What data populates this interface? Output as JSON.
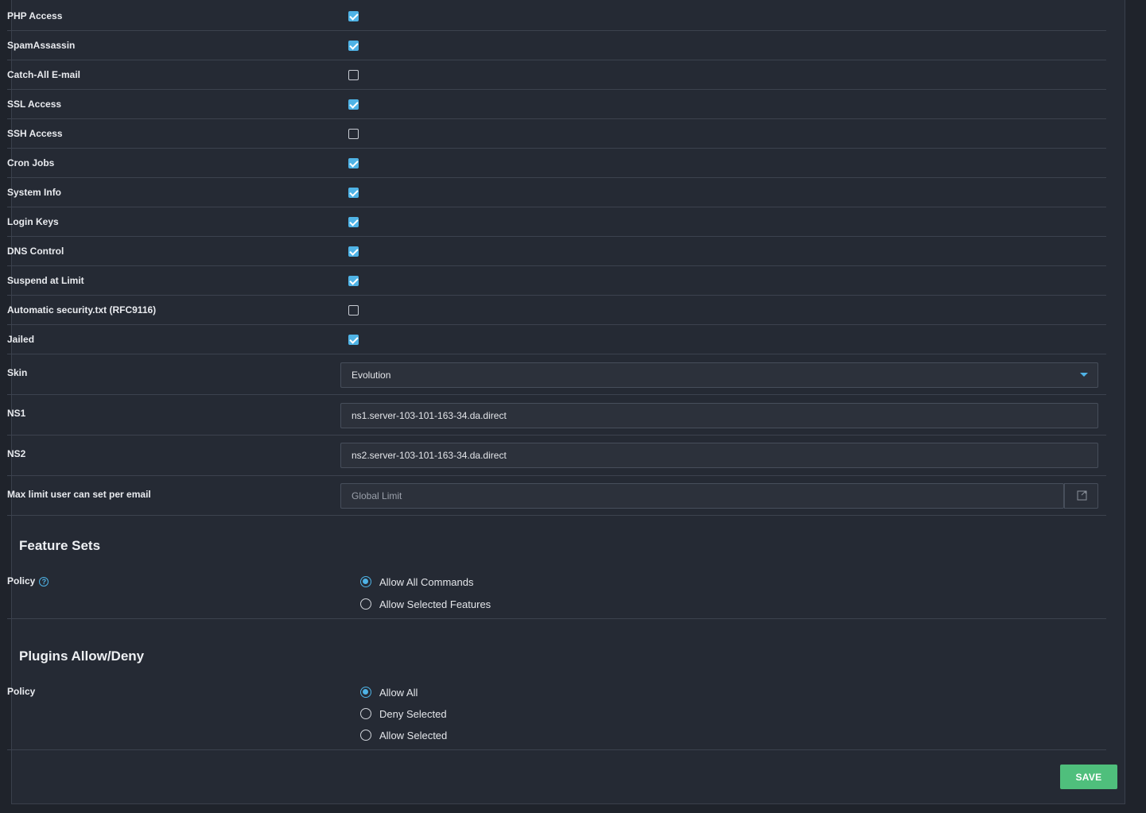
{
  "options": [
    {
      "label": "PHP Access",
      "checked": true
    },
    {
      "label": "SpamAssassin",
      "checked": true
    },
    {
      "label": "Catch-All E-mail",
      "checked": false
    },
    {
      "label": "SSL Access",
      "checked": true
    },
    {
      "label": "SSH Access",
      "checked": false
    },
    {
      "label": "Cron Jobs",
      "checked": true
    },
    {
      "label": "System Info",
      "checked": true
    },
    {
      "label": "Login Keys",
      "checked": true
    },
    {
      "label": "DNS Control",
      "checked": true
    },
    {
      "label": "Suspend at Limit",
      "checked": true
    },
    {
      "label": "Automatic security.txt (RFC9116)",
      "checked": false
    },
    {
      "label": "Jailed",
      "checked": true
    }
  ],
  "skin": {
    "label": "Skin",
    "value": "Evolution"
  },
  "ns1": {
    "label": "NS1",
    "value": "ns1.server-103-101-163-34.da.direct"
  },
  "ns2": {
    "label": "NS2",
    "value": "ns2.server-103-101-163-34.da.direct"
  },
  "email_limit": {
    "label": "Max limit user can set per email",
    "placeholder": "Global Limit"
  },
  "feature_sets": {
    "title": "Feature Sets",
    "policy_label": "Policy",
    "options": [
      {
        "label": "Allow All Commands",
        "selected": true
      },
      {
        "label": "Allow Selected Features",
        "selected": false
      }
    ]
  },
  "plugins": {
    "title": "Plugins Allow/Deny",
    "policy_label": "Policy",
    "options": [
      {
        "label": "Allow All",
        "selected": true
      },
      {
        "label": "Deny Selected",
        "selected": false
      },
      {
        "label": "Allow Selected",
        "selected": false
      }
    ]
  },
  "save_label": "SAVE",
  "colors": {
    "accent": "#4fb3e6",
    "save": "#4fbf7c",
    "background": "#252a34"
  }
}
